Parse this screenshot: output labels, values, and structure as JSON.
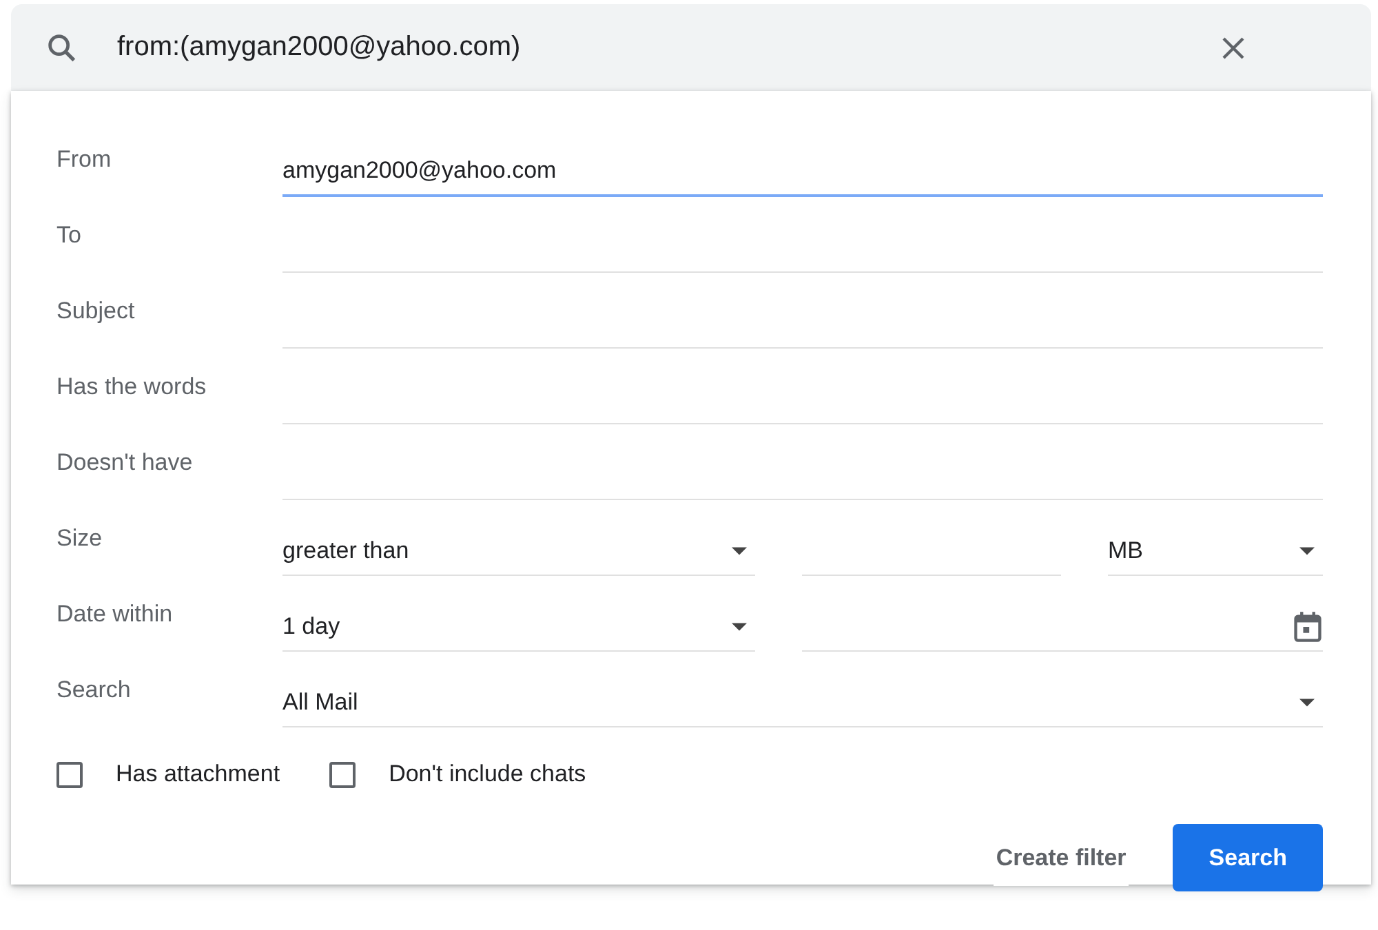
{
  "search_bar": {
    "query": "from:(amygan2000@yahoo.com)"
  },
  "rows": [
    {
      "label": "From",
      "controls": [
        {
          "kind": "text",
          "value": "amygan2000@yahoo.com",
          "focused": true
        }
      ]
    },
    {
      "label": "To",
      "controls": [
        {
          "kind": "text",
          "focused": false
        }
      ]
    },
    {
      "label": "Subject",
      "controls": [
        {
          "kind": "text",
          "focused": false
        }
      ]
    },
    {
      "label": "Has the words",
      "controls": [
        {
          "kind": "text",
          "focused": false
        }
      ]
    },
    {
      "label": "Doesn't have",
      "controls": [
        {
          "kind": "text",
          "focused": false
        }
      ]
    },
    {
      "label": "Size",
      "controls": [
        {
          "kind": "select",
          "value": "greater than"
        },
        {
          "kind": "text",
          "focused": false
        },
        {
          "kind": "select",
          "value": "MB"
        }
      ]
    },
    {
      "label": "Date within",
      "controls": [
        {
          "kind": "select",
          "value": "1 day"
        },
        {
          "kind": "date"
        }
      ]
    },
    {
      "label": "Search",
      "controls": [
        {
          "kind": "select",
          "value": "All Mail"
        }
      ]
    }
  ],
  "checkboxes": [
    {
      "label": "Has attachment",
      "checked": false
    },
    {
      "label": "Don't include chats",
      "checked": false
    }
  ],
  "buttons": [
    {
      "label": "Create filter",
      "kind": "text"
    },
    {
      "label": "Search",
      "kind": "primary"
    }
  ]
}
